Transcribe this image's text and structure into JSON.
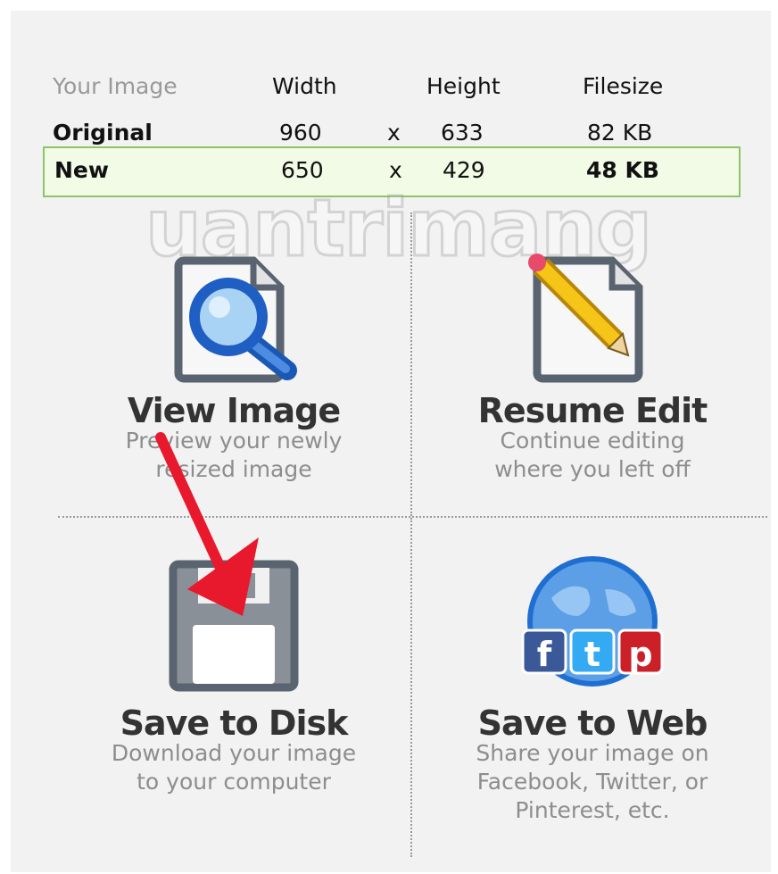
{
  "table": {
    "headers": [
      "Your Image",
      "Width",
      "Height",
      "Filesize"
    ],
    "rows": [
      {
        "label": "Original",
        "width": "960",
        "sep": "x",
        "height": "633",
        "size": "82 KB"
      },
      {
        "label": "New",
        "width": "650",
        "sep": "x",
        "height": "429",
        "size": "48 KB"
      }
    ]
  },
  "watermark": {
    "text": "uantrimang"
  },
  "actions": {
    "view": {
      "title": "View Image",
      "line1": "Preview your newly",
      "line2": "resized image",
      "icon": "magnifier-document-icon"
    },
    "resume": {
      "title": "Resume Edit",
      "line1": "Continue editing",
      "line2": "where you left off",
      "icon": "pencil-document-icon"
    },
    "save_disk": {
      "title": "Save to Disk",
      "line1": "Download your image",
      "line2": "to your computer",
      "icon": "floppy-disk-icon"
    },
    "save_web": {
      "title": "Save to Web",
      "line1": "Share your image on",
      "line2": "Facebook, Twitter, or",
      "line3": "Pinterest, etc.",
      "icon": "globe-social-icon"
    }
  },
  "colors": {
    "highlight_border": "#8cc567",
    "highlight_bg": "#f2fbe6",
    "arrow": "#e8192c",
    "globe": "#1f6fd1"
  }
}
